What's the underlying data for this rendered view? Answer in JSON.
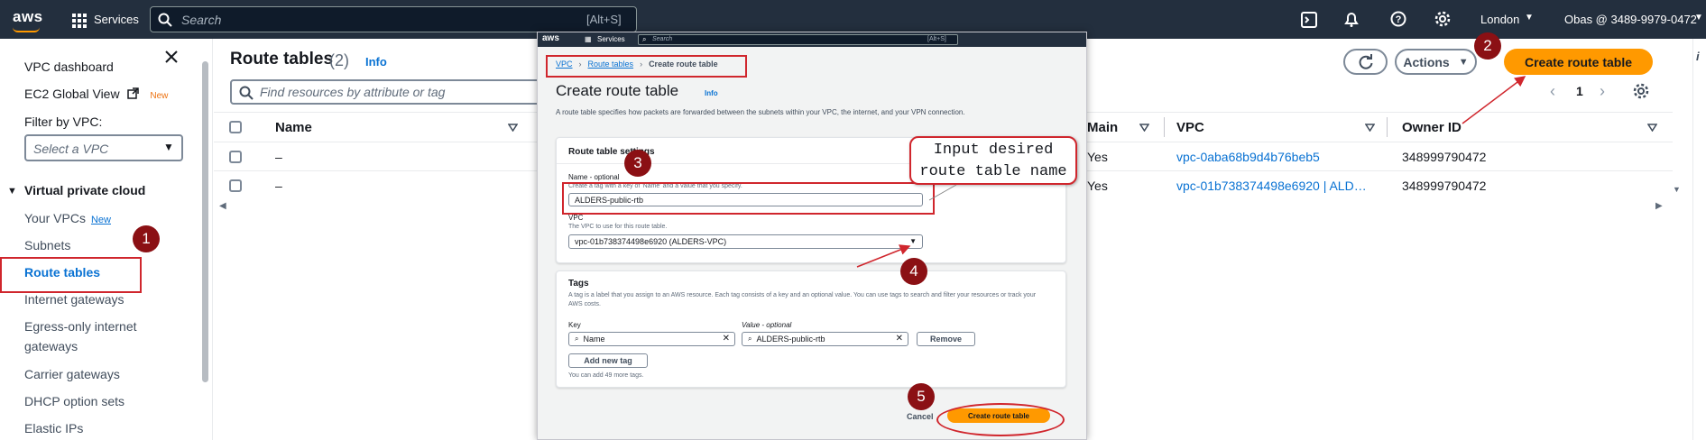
{
  "topnav": {
    "logo": "aws",
    "services": "Services",
    "search_placeholder": "Search",
    "shortcut": "[Alt+S]",
    "region": "London",
    "account": "Obas @ 3489-9979-0472"
  },
  "sidebar": {
    "title": "VPC dashboard",
    "ec2": "EC2 Global View",
    "new": "New",
    "filter_label": "Filter by VPC:",
    "filter_placeholder": "Select a VPC",
    "section": "Virtual private cloud",
    "items": [
      "Your VPCs",
      "Subnets",
      "Route tables",
      "Internet gateways",
      "Egress-only internet",
      "gateways",
      "Carrier gateways",
      "DHCP option sets",
      "Elastic IPs"
    ]
  },
  "main": {
    "title": "Route tables",
    "count": "(2)",
    "info": "Info",
    "search_placeholder": "Find resources by attribute or tag",
    "actions": "Actions",
    "create": "Create route table",
    "page": "1",
    "columns": [
      "Name",
      "Main",
      "VPC",
      "Owner ID"
    ],
    "rows": [
      {
        "name": "–",
        "main": "Yes",
        "vpc": "vpc-0aba68b9d4b76beb5",
        "owner": "348999790472"
      },
      {
        "name": "–",
        "main": "Yes",
        "vpc": "vpc-01b738374498e6920 | ALD…",
        "owner": "348999790472"
      }
    ]
  },
  "modal": {
    "nav": {
      "logo": "aws",
      "services": "Services",
      "search": "Search",
      "shortcut": "[Alt+S]"
    },
    "breadcrumb": [
      "VPC",
      "Route tables",
      "Create route table"
    ],
    "title": "Create route table",
    "info": "Info",
    "description": "A route table specifies how packets are forwarded between the subnets within your VPC, the internet, and your VPN connection.",
    "settings": {
      "header": "Route table settings",
      "name_label": "Name - optional",
      "name_hint": "Create a tag with a key of 'Name' and a value that you specify.",
      "name_value": "ALDERS-public-rtb",
      "vpc_label": "VPC",
      "vpc_hint": "The VPC to use for this route table.",
      "vpc_value": "vpc-01b738374498e6920 (ALDERS-VPC)"
    },
    "tags": {
      "header": "Tags",
      "desc": "A tag is a label that you assign to an AWS resource. Each tag consists of a key and an optional value. You can use tags to search and filter your resources or track your AWS costs.",
      "key_label": "Key",
      "value_label": "Value - optional",
      "key_value": "Name",
      "value_value": "ALDERS-public-rtb",
      "remove": "Remove",
      "add": "Add new tag",
      "more": "You can add 49 more tags."
    },
    "cancel": "Cancel",
    "create": "Create route table"
  },
  "annotations": {
    "steps": [
      "1",
      "2",
      "3",
      "4",
      "5"
    ],
    "callout_line1": "Input desired",
    "callout_line2": "route table name"
  },
  "colors": {
    "nav": "#232f3e",
    "accent": "#ff9900",
    "link": "#0972d3",
    "annotation": "#d0262d"
  }
}
